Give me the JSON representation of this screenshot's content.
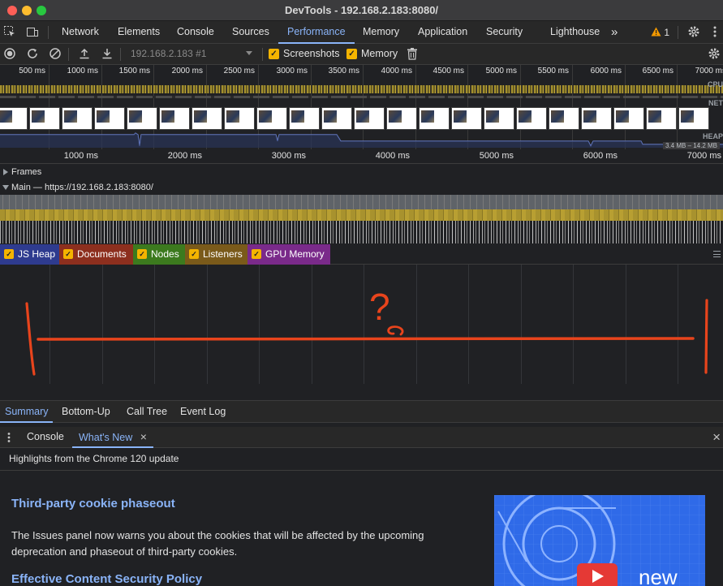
{
  "window": {
    "title": "DevTools - 192.168.2.183:8080/"
  },
  "tabs": [
    "Network",
    "Elements",
    "Console",
    "Sources",
    "Performance",
    "Memory",
    "Application",
    "Security",
    "Lighthouse"
  ],
  "tab_active": "Performance",
  "tab_overflow": "»",
  "warnings": {
    "count": "1"
  },
  "toolbar": {
    "profile_select": "192.168.2.183 #1",
    "screenshots_label": "Screenshots",
    "memory_label": "Memory"
  },
  "overview": {
    "ticks": [
      "500 ms",
      "1000 ms",
      "1500 ms",
      "2000 ms",
      "2500 ms",
      "3000 ms",
      "3500 ms",
      "4000 ms",
      "4500 ms",
      "5000 ms",
      "5500 ms",
      "6000 ms",
      "6500 ms",
      "7000 ms"
    ],
    "cpu_label": "CPU",
    "net_label": "NET",
    "heap_label": "HEAP",
    "heap_range": "3.4 MB – 14.2 MB"
  },
  "timeline": {
    "ticks": [
      "1000 ms",
      "2000 ms",
      "3000 ms",
      "4000 ms",
      "5000 ms",
      "6000 ms",
      "7000 ms"
    ],
    "frames_label": "Frames",
    "main_label": "Main — https://192.168.2.183:8080/"
  },
  "counters": [
    {
      "label": "JS Heap",
      "color": "#2e3b8f"
    },
    {
      "label": "Documents",
      "color": "#8d2f1e"
    },
    {
      "label": "Nodes",
      "color": "#3c7a1e"
    },
    {
      "label": "Listeners",
      "color": "#7a5a1a"
    },
    {
      "label": "GPU Memory",
      "color": "#7a2a8a"
    }
  ],
  "annotation": {
    "text": "?",
    "color": "#e8441c"
  },
  "bottom_tabs": [
    "Summary",
    "Bottom-Up",
    "Call Tree",
    "Event Log"
  ],
  "bottom_tab_active": "Summary",
  "drawer": {
    "tabs": [
      "Console",
      "What's New"
    ],
    "active": "What's New",
    "close_glyph": "×"
  },
  "whats_new": {
    "highlights": "Highlights from the Chrome 120 update",
    "sections": [
      {
        "title": "Third-party cookie phaseout",
        "body": "The Issues panel now warns you about the cookies that will be affected by the upcoming deprecation and phaseout of third-party cookies."
      },
      {
        "title": "Effective Content Security Policy",
        "body": ""
      }
    ],
    "promo_word": "new"
  },
  "colors": {
    "accent": "#8ab4f8",
    "checkbox": "#f4b400",
    "warning": "#f29900"
  }
}
